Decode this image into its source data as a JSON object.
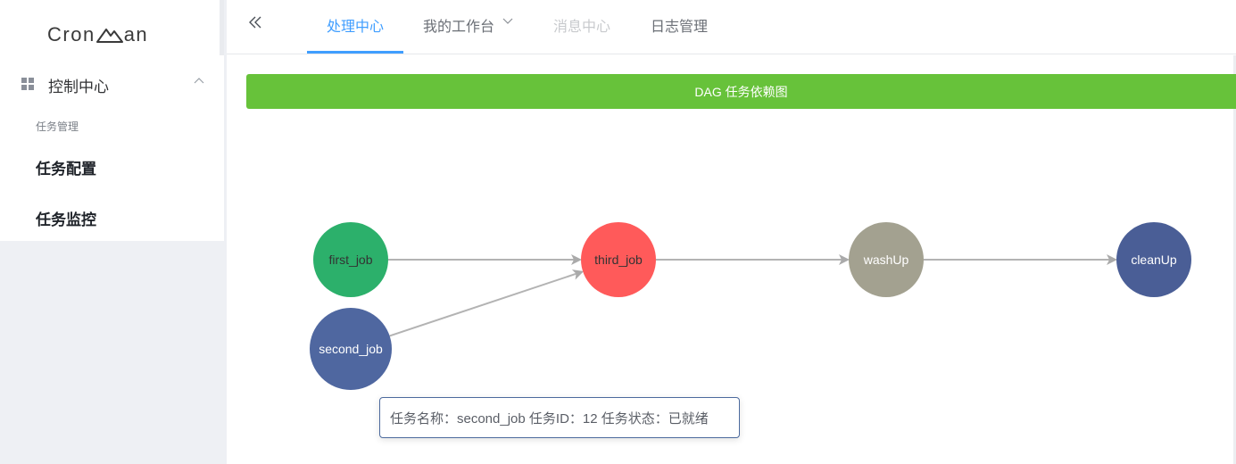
{
  "app": {
    "logo_text_pre": "Cron",
    "logo_text_post": "an"
  },
  "sidebar": {
    "menu_head": "控制中心",
    "group_label": "任务管理",
    "items": [
      {
        "label": "任务配置"
      },
      {
        "label": "任务监控"
      }
    ]
  },
  "topnav": {
    "tabs": [
      {
        "label": "处理中心",
        "state": "active"
      },
      {
        "label": "我的工作台",
        "state": "normal",
        "has_dropdown": true
      },
      {
        "label": "消息中心",
        "state": "disabled"
      },
      {
        "label": "日志管理",
        "state": "normal"
      }
    ]
  },
  "banner": {
    "text": "DAG 任务依赖图",
    "color": "#67c23a"
  },
  "dag": {
    "nodes": [
      {
        "id": "first_job",
        "label": "first_job",
        "color": "#2cb06b"
      },
      {
        "id": "second_job",
        "label": "second_job",
        "color": "#4f67a0"
      },
      {
        "id": "third_job",
        "label": "third_job",
        "color": "#ff5a5a"
      },
      {
        "id": "washUp",
        "label": "washUp",
        "color": "#a3a190"
      },
      {
        "id": "cleanUp",
        "label": "cleanUp",
        "color": "#4a5e96"
      }
    ],
    "edges": [
      {
        "from": "first_job",
        "to": "third_job"
      },
      {
        "from": "second_job",
        "to": "third_job"
      },
      {
        "from": "third_job",
        "to": "washUp"
      },
      {
        "from": "washUp",
        "to": "cleanUp"
      }
    ]
  },
  "tooltip": {
    "text": "任务名称：second_job 任务ID：12 任务状态：已就绪"
  },
  "colors": {
    "accent": "#409eff",
    "success": "#67c23a"
  }
}
